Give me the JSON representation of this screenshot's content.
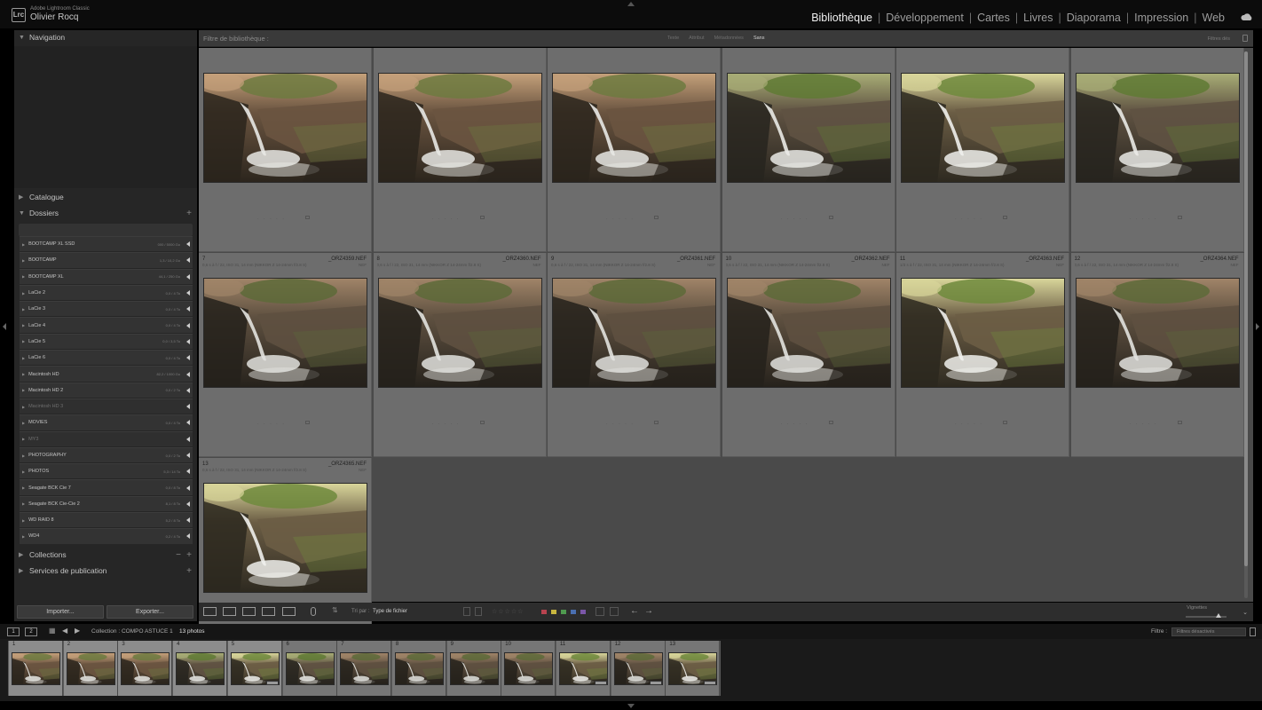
{
  "app": {
    "logo_text": "Lrc",
    "subtitle": "Adobe Lightroom Classic",
    "user": "Olivier Rocq"
  },
  "modules": [
    "Bibliothèque",
    "Développement",
    "Cartes",
    "Livres",
    "Diaporama",
    "Impression",
    "Web"
  ],
  "modules_active": "Bibliothèque",
  "left_panel": {
    "navigation": "Navigation",
    "catalogue": "Catalogue",
    "dossiers": "Dossiers",
    "collections": "Collections",
    "publish": "Services de publication",
    "folders": [
      {
        "name": "BOOTCAMP XL SSD",
        "size": "000 / 5000 Go",
        "dim": false
      },
      {
        "name": "BOOTCAMP",
        "size": "1,3 / 10,2 Go",
        "dim": false
      },
      {
        "name": "BOOTCAMP XL",
        "size": "44,1 / 250 Go",
        "dim": false
      },
      {
        "name": "LaCie 2",
        "size": "0,0 / 4 To",
        "dim": false
      },
      {
        "name": "LaCie 3",
        "size": "0,0 / 4 To",
        "dim": false
      },
      {
        "name": "LaCie 4",
        "size": "0,0 / 4 To",
        "dim": false
      },
      {
        "name": "LaCie 5",
        "size": "0,0 / 3,5 To",
        "dim": false
      },
      {
        "name": "LaCie 6",
        "size": "0,0 / 4 To",
        "dim": false
      },
      {
        "name": "Macintosh HD",
        "size": "82,2 / 1000 Go",
        "dim": false
      },
      {
        "name": "Macintosh HD 2",
        "size": "0,0 / 2 To",
        "dim": false
      },
      {
        "name": "Macintosh HD 3",
        "size": "",
        "dim": true
      },
      {
        "name": "MOVIES",
        "size": "0,0 / 4 To",
        "dim": false
      },
      {
        "name": "MY3",
        "size": "",
        "dim": true
      },
      {
        "name": "PHOTOGRAPHY",
        "size": "0,0 / 2 To",
        "dim": false
      },
      {
        "name": "PHOTOS",
        "size": "5,3 / 14 To",
        "dim": false
      },
      {
        "name": "Seagate BCK Cie 7",
        "size": "0,0 / 8 To",
        "dim": false
      },
      {
        "name": "Seagate BCK Cie-Cie 2",
        "size": "8,1 / 8 To",
        "dim": false
      },
      {
        "name": "WD RAID 8",
        "size": "5,2 / 8 To",
        "dim": false
      },
      {
        "name": "WD4",
        "size": "0,2 / 4 To",
        "dim": false
      }
    ],
    "import_label": "Importer...",
    "export_label": "Exporter..."
  },
  "filter_bar": {
    "title": "Filtre de bibliothèque :",
    "tabs": [
      "Texte",
      "Attribut",
      "Métadonnées",
      "Sans"
    ],
    "active_tab": "Sans",
    "preset": "Filtres dés"
  },
  "grid": {
    "cells": [
      {
        "idx": "",
        "name": "",
        "meta": "",
        "ext": "",
        "tone": "warm"
      },
      {
        "idx": "",
        "name": "",
        "meta": "",
        "ext": "",
        "tone": "warm"
      },
      {
        "idx": "",
        "name": "",
        "meta": "",
        "ext": "",
        "tone": "warm"
      },
      {
        "idx": "",
        "name": "",
        "meta": "",
        "ext": "",
        "tone": "green"
      },
      {
        "idx": "",
        "name": "",
        "meta": "",
        "ext": "",
        "tone": "greenbright"
      },
      {
        "idx": "",
        "name": "",
        "meta": "",
        "ext": "",
        "tone": "green"
      },
      {
        "idx": "7",
        "name": "_ORZ4359.NEF",
        "meta": "0,6 s à f / 22, ISO 31, 14 mm (NIKKOR Z 14-24mm f/2.8 S)",
        "ext": "NEF",
        "tone": "mid"
      },
      {
        "idx": "8",
        "name": "_ORZ4360.NEF",
        "meta": "0,6 s à f / 22, ISO 31, 14 mm (NIKKOR Z 14-24mm f/2.8 S)",
        "ext": "NEF",
        "tone": "mid"
      },
      {
        "idx": "9",
        "name": "_ORZ4361.NEF",
        "meta": "0,6 s à f / 22, ISO 31, 14 mm (NIKKOR Z 14-24mm f/2.8 S)",
        "ext": "NEF",
        "tone": "mid"
      },
      {
        "idx": "10",
        "name": "_ORZ4362.NEF",
        "meta": "0,6 s à f / 22, ISO 31, 14 mm (NIKKOR Z 14-24mm f/2.8 S)",
        "ext": "NEF",
        "tone": "mid"
      },
      {
        "idx": "11",
        "name": "_ORZ4363.NEF",
        "meta": "1/3 s à f / 22, ISO 31, 14 mm (NIKKOR Z 14-24mm f/2.8 S)",
        "ext": "NEF",
        "tone": "greenbright"
      },
      {
        "idx": "12",
        "name": "_ORZ4364.NEF",
        "meta": "0,6 s à f / 22, ISO 31, 14 mm (NIKKOR Z 14-24mm f/2.8 S)",
        "ext": "NEF",
        "tone": "mid"
      },
      {
        "idx": "13",
        "name": "_ORZ4365.NEF",
        "meta": "0,6 s à f / 22, ISO 31, 14 mm (NIKKOR Z 14-24mm f/2.8 S)",
        "ext": "NEF",
        "tone": "greenbright"
      }
    ],
    "stars": "· · · · ·"
  },
  "toolbar": {
    "sort_label": "Tri par :",
    "sort_value": "Type de fichier",
    "stars": "☆☆☆☆☆",
    "colors": [
      "#b8434f",
      "#c8b63f",
      "#4f9a4f",
      "#4a6fb0",
      "#7b57a8"
    ],
    "vignettes_label": "Vignettes"
  },
  "filmstrip": {
    "page1": "1",
    "page2": "2",
    "source": "Collection : COMPO ASTUCE 1",
    "count": "13 photos",
    "filter_label": "Filtre :",
    "filter_value": "Filtres désactivés",
    "items": [
      {
        "num": "1",
        "badge": false,
        "tone": "warm"
      },
      {
        "num": "2",
        "badge": false,
        "tone": "warm"
      },
      {
        "num": "3",
        "badge": false,
        "tone": "warm"
      },
      {
        "num": "4",
        "badge": false,
        "tone": "green"
      },
      {
        "num": "5",
        "badge": true,
        "tone": "greenbright"
      },
      {
        "num": "6",
        "badge": false,
        "tone": "green"
      },
      {
        "num": "7",
        "badge": false,
        "tone": "mid"
      },
      {
        "num": "8",
        "badge": false,
        "tone": "mid"
      },
      {
        "num": "9",
        "badge": false,
        "tone": "mid"
      },
      {
        "num": "10",
        "badge": false,
        "tone": "mid"
      },
      {
        "num": "11",
        "badge": true,
        "tone": "greenbright"
      },
      {
        "num": "12",
        "badge": true,
        "tone": "mid"
      },
      {
        "num": "13",
        "badge": true,
        "tone": "greenbright"
      }
    ]
  }
}
